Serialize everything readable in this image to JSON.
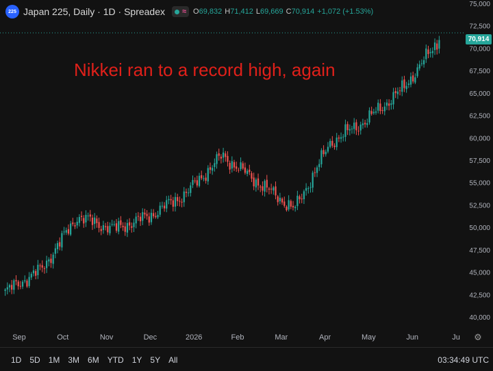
{
  "header": {
    "symbol_badge": "225",
    "title": "Japan 225, Daily · 1D · Spreadex",
    "status_icon": "wave-icon",
    "ohlc": [
      {
        "label": "O",
        "value": "69,832"
      },
      {
        "label": "H",
        "value": "71,412"
      },
      {
        "label": "L",
        "value": "69,669"
      },
      {
        "label": "C",
        "value": "70,914"
      },
      {
        "label": "",
        "value": "+1,072 (+1.53%)"
      }
    ]
  },
  "annotation": "Nikkei ran to a record high, again",
  "last_price_tag": "70,914",
  "colors": {
    "up": "#26a69a",
    "down": "#ef5350",
    "annotation": "#e0201a",
    "background": "#121212"
  },
  "bottom": {
    "ranges": [
      "1D",
      "5D",
      "1M",
      "3M",
      "6M",
      "YTD",
      "1Y",
      "5Y",
      "All"
    ],
    "clock": "03:34:49 UTC",
    "settings_icon": "gear-icon"
  },
  "chart_data": {
    "type": "candlestick",
    "grid": false,
    "ylim": [
      40000,
      75000
    ],
    "y_ticks": [
      "40,000",
      "42,500",
      "45,000",
      "47,500",
      "50,000",
      "52,500",
      "55,000",
      "57,500",
      "60,000",
      "62,500",
      "65,000",
      "67,500",
      "70,000",
      "72,500",
      "75,000"
    ],
    "x_ticks": [
      "Sep",
      "Oct",
      "Nov",
      "Dec",
      "2026",
      "Feb",
      "Mar",
      "Apr",
      "May",
      "Jun",
      "Ju"
    ],
    "last_close": 70914,
    "close_path": [
      {
        "month": "Sep",
        "close": 42800
      },
      {
        "month": "Oct",
        "close": 45300
      },
      {
        "month": "Nov",
        "close": 51200
      },
      {
        "month": "Dec",
        "close": 49800
      },
      {
        "month": "2026",
        "close": 51300
      },
      {
        "month": "Feb",
        "close": 53800
      },
      {
        "month": "Feb",
        "close": 58000
      },
      {
        "month": "Mar",
        "close": 55000
      },
      {
        "month": "Apr",
        "close": 52000
      },
      {
        "month": "May",
        "close": 59500
      },
      {
        "month": "May",
        "close": 62000
      },
      {
        "month": "Jun",
        "close": 65500
      },
      {
        "month": "Jun",
        "close": 70914
      }
    ]
  }
}
